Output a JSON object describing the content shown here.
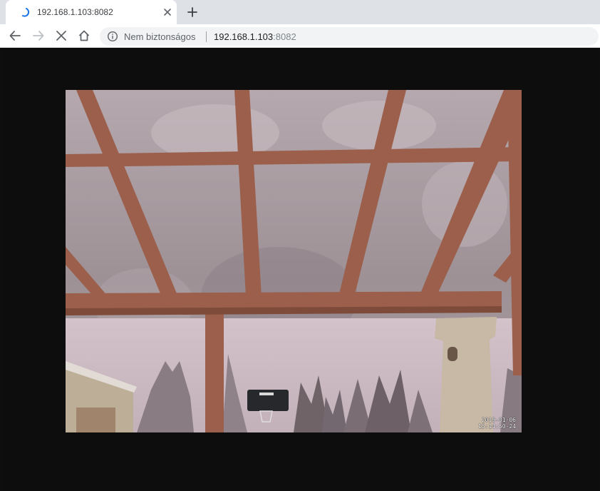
{
  "browser": {
    "tab": {
      "title": "192.168.1.103:8082",
      "icon": "loading-spinner-icon",
      "close_icon": "close-icon"
    },
    "new_tab_icon": "plus-icon",
    "toolbar": {
      "back_icon": "arrow-left-icon",
      "forward_icon": "arrow-right-icon",
      "stop_icon": "close-icon",
      "home_icon": "home-icon"
    },
    "omnibox": {
      "security_icon": "info-icon",
      "security_label": "Nem biztonságos",
      "url_host": "192.168.1.103",
      "url_port": ":8082"
    }
  },
  "page": {
    "camera_stream": {
      "timestamp_date": "2019-01-06",
      "timestamp_time": "15:14:50-24"
    }
  },
  "colors": {
    "tabstrip": "#dee1e6",
    "page_background": "#0e0e0e",
    "spinner": "#1a73e8"
  }
}
